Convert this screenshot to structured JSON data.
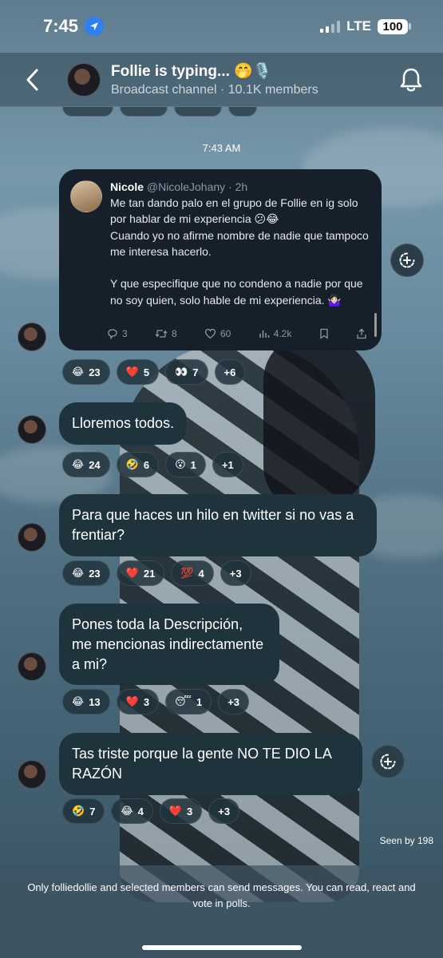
{
  "status_bar": {
    "time": "7:45",
    "network": "LTE",
    "battery": "100"
  },
  "header": {
    "title": "Follie is typing... 🤭🎙️",
    "subtitle": "Broadcast channel · 10.1K members"
  },
  "timestamp": "7:43 AM",
  "tweet": {
    "name": "Nicole",
    "handle": "@NicoleJohany · 2h",
    "body": "Me tan dando palo en el grupo de Follie en ig solo por hablar de mi experiencia 😕😂\nCuando yo no afirme nombre de nadie que tampoco me interesa hacerlo.\n\nY que especifique que no condeno a nadie por que no soy quien, solo hable de mi experiencia. 🤷🏻‍♀️",
    "replies": "3",
    "retweets": "8",
    "likes": "60",
    "views": "4.2k"
  },
  "tweet_reactions": [
    {
      "emoji": "😂",
      "count": "23"
    },
    {
      "emoji": "❤️",
      "count": "5"
    },
    {
      "emoji": "👀",
      "count": "7"
    },
    {
      "emoji": "",
      "count": "+6"
    }
  ],
  "messages": [
    {
      "text": "Lloremos todos.",
      "reactions": [
        {
          "emoji": "😂",
          "count": "24"
        },
        {
          "emoji": "🤣",
          "count": "6"
        },
        {
          "emoji": "😮",
          "count": "1"
        },
        {
          "emoji": "",
          "count": "+1"
        }
      ]
    },
    {
      "text": "Para que haces un hilo en twitter si no vas a frentiar?",
      "reactions": [
        {
          "emoji": "😂",
          "count": "23"
        },
        {
          "emoji": "❤️",
          "count": "21"
        },
        {
          "emoji": "💯",
          "count": "4"
        },
        {
          "emoji": "",
          "count": "+3"
        }
      ]
    },
    {
      "text": "Pones toda la Descripción, me mencionas indirectamente a mi?",
      "reactions": [
        {
          "emoji": "😂",
          "count": "13"
        },
        {
          "emoji": "❤️",
          "count": "3"
        },
        {
          "emoji": "😴",
          "count": "1"
        },
        {
          "emoji": "",
          "count": "+3"
        }
      ]
    },
    {
      "text": "Tas triste porque la gente NO TE DIO LA RAZÓN",
      "reactions": [
        {
          "emoji": "🤣",
          "count": "7"
        },
        {
          "emoji": "😂",
          "count": "4"
        },
        {
          "emoji": "❤️",
          "count": "3"
        },
        {
          "emoji": "",
          "count": "+3"
        }
      ]
    }
  ],
  "seen_by": "Seen by 198",
  "footer_text": "Only folliedollie and selected members can send messages. You can read, react and vote in polls.",
  "colors": {
    "bubble": "#1f333d",
    "tweet_bg": "#15202b",
    "location_badge": "#2f7ff0"
  }
}
